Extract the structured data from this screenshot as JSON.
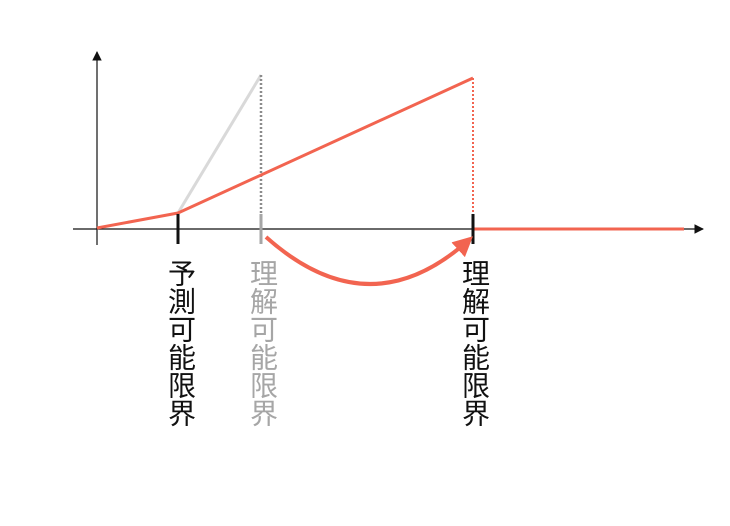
{
  "labels": {
    "prediction_limit": "予測可能限界",
    "understanding_limit_old": "理解可能限界",
    "understanding_limit_new": "理解可能限界"
  },
  "colors": {
    "axis": "#111111",
    "red_line": "#f26450",
    "gray_line": "#d9d9d9",
    "gray_text": "#a6a6a6",
    "gray_dotted": "#8c8c8c",
    "black_text": "#111111"
  }
}
